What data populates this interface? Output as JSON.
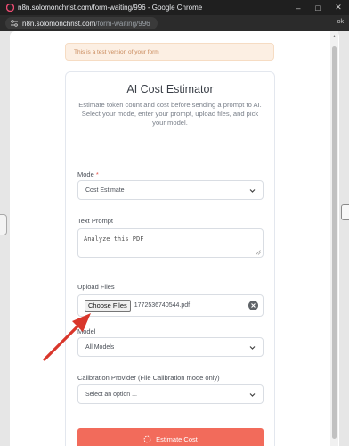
{
  "window": {
    "title": "n8n.solomonchrist.com/form-waiting/996 - Google Chrome",
    "url_host": "n8n.solomonchrist.com",
    "url_path": "/form-waiting/996",
    "ext_text": "ok"
  },
  "banner": {
    "text": "This is a test version of your form"
  },
  "form": {
    "title": "AI Cost Estimator",
    "description": "Estimate token count and cost before sending a prompt to AI. Select your mode, enter your prompt, upload files, and pick your model.",
    "mode": {
      "label": "Mode",
      "required_mark": "*",
      "value": "Cost Estimate"
    },
    "prompt": {
      "label": "Text Prompt",
      "value": "Analyze this PDF"
    },
    "upload": {
      "label": "Upload Files",
      "button_label": "Choose Files",
      "file_name": "1772536740544.pdf"
    },
    "model": {
      "label": "Model",
      "value": "All Models"
    },
    "calibration": {
      "label": "Calibration Provider (File Calibration mode only)",
      "value": "Select an option ..."
    },
    "submit": {
      "label": "Estimate Cost"
    }
  },
  "colors": {
    "accent": "#f26b5b",
    "annotation_arrow": "#d9362b",
    "banner_bg": "#fcefe3"
  }
}
